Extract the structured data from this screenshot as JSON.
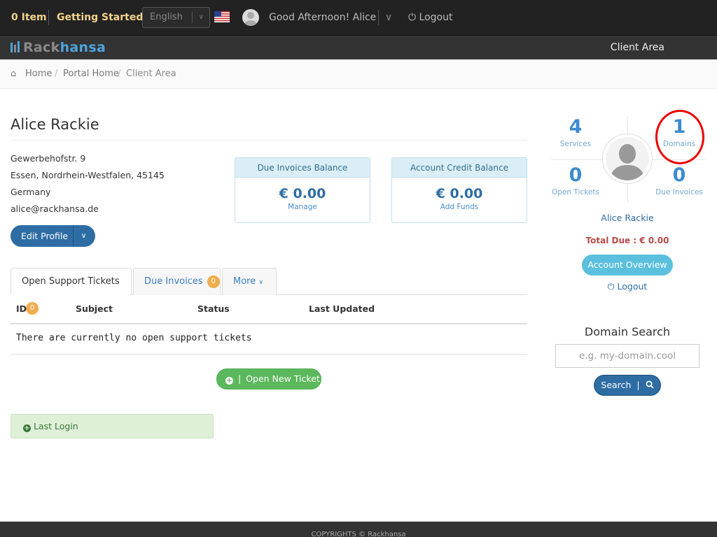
{
  "topbar": {
    "cart_label": "0 Item",
    "getting_started": "Getting Started",
    "language": "English",
    "greeting": "Good Afternoon! Alice",
    "logout": "Logout"
  },
  "brand": {
    "logo_part1": "Rack",
    "logo_part2": "hansa",
    "client_area": "Client Area"
  },
  "breadcrumb": {
    "items": [
      "Home",
      "Portal Home",
      "Client Area"
    ]
  },
  "profile": {
    "name": "Alice Rackie",
    "address": [
      "Gewerbehofstr. 9",
      "Essen, Nordrhein-Westfalen, 45145",
      "Germany",
      "alice@rackhansa.de"
    ],
    "edit_button": "Edit Profile"
  },
  "panels": {
    "due_invoices": {
      "title": "Due Invoices Balance",
      "amount": "€ 0.00",
      "link": "Manage"
    },
    "credit": {
      "title": "Account Credit Balance",
      "amount": "€ 0.00",
      "link": "Add Funds"
    }
  },
  "tabs": [
    {
      "label": "Open Support Tickets",
      "badge": "0"
    },
    {
      "label": "Due Invoices",
      "badge": "0"
    },
    {
      "label": "More"
    }
  ],
  "table": {
    "headers": [
      "ID",
      "Subject",
      "Status",
      "Last Updated"
    ],
    "empty_message": "There are currently no open support tickets"
  },
  "actions": {
    "open_ticket": "Open New Ticket",
    "last_login": "Last Login"
  },
  "stats": {
    "services": {
      "value": "4",
      "label": "Services"
    },
    "domains": {
      "value": "1",
      "label": "Domains"
    },
    "open_tickets": {
      "value": "0",
      "label": "Open Tickets"
    },
    "due_invoices": {
      "value": "0",
      "label": "Due Invoices"
    }
  },
  "sidebar": {
    "name": "Alice Rackie",
    "total_due": "Total Due : € 0.00",
    "overview_button": "Account Overview",
    "logout": "Logout"
  },
  "domain_search": {
    "title": "Domain Search",
    "placeholder": "e.g. my-domain.cool",
    "button": "Search"
  },
  "footer": {
    "text": "COPYRIGHTS © Rackhansa"
  },
  "colors": {
    "primary": "#2e6da4",
    "success": "#5cb85c",
    "info": "#5bc0de",
    "badge": "#f0ad4e",
    "highlight_ring": "#e00000"
  }
}
